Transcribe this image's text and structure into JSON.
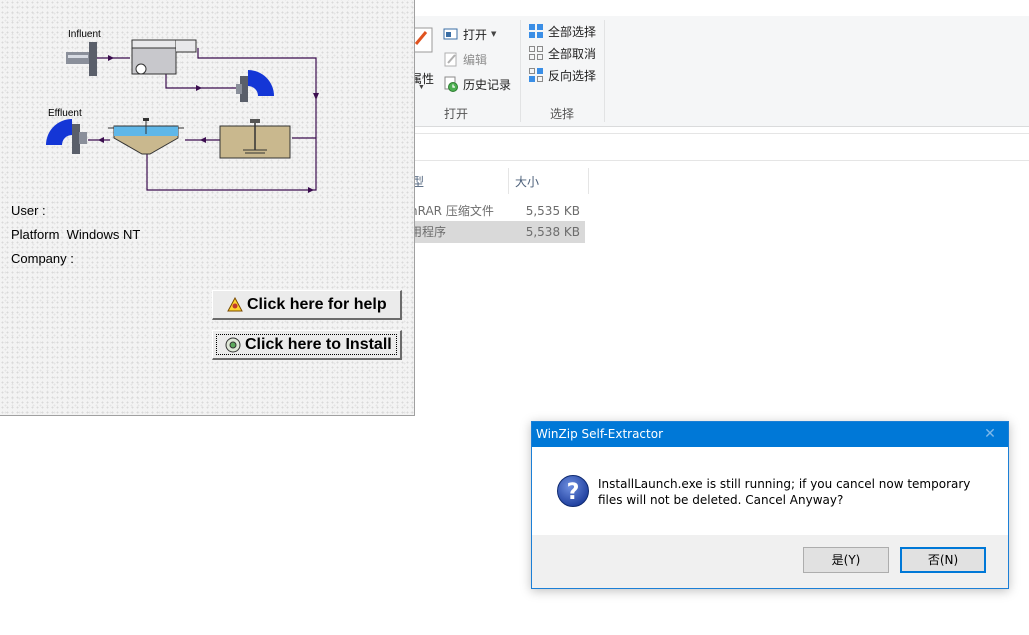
{
  "explorer": {
    "ribbon": {
      "open_group": {
        "properties_label": "属性",
        "open_label": "打开",
        "edit_label": "编辑",
        "history_label": "历史记录",
        "group_label": "打开"
      },
      "select_group": {
        "select_all_label": "全部选择",
        "select_none_label": "全部取消",
        "invert_label": "反向选择",
        "group_label": "选择"
      }
    },
    "columns": {
      "type_header": "型",
      "size_header": "大小"
    },
    "files": [
      {
        "type": "nRAR 压缩文件",
        "size": "5,535 KB",
        "selected": false
      },
      {
        "type": "用程序",
        "size": "5,538 KB",
        "selected": true
      }
    ]
  },
  "launcher": {
    "diagram": {
      "influent_label": "Influent",
      "effluent_label": "Effluent"
    },
    "user_label": "User :",
    "platform_label": "Platform  Windows NT",
    "company_label": "Company :",
    "help_button_label": "Click here for help",
    "install_button_label": "Click here to Install"
  },
  "dialog": {
    "title": "WinZip Self-Extractor",
    "icon": "question-icon",
    "message": "InstallLaunch.exe is still running; if you cancel now temporary files will not be deleted. Cancel Anyway?",
    "yes_label": "是(Y)",
    "no_label": "否(N)"
  }
}
